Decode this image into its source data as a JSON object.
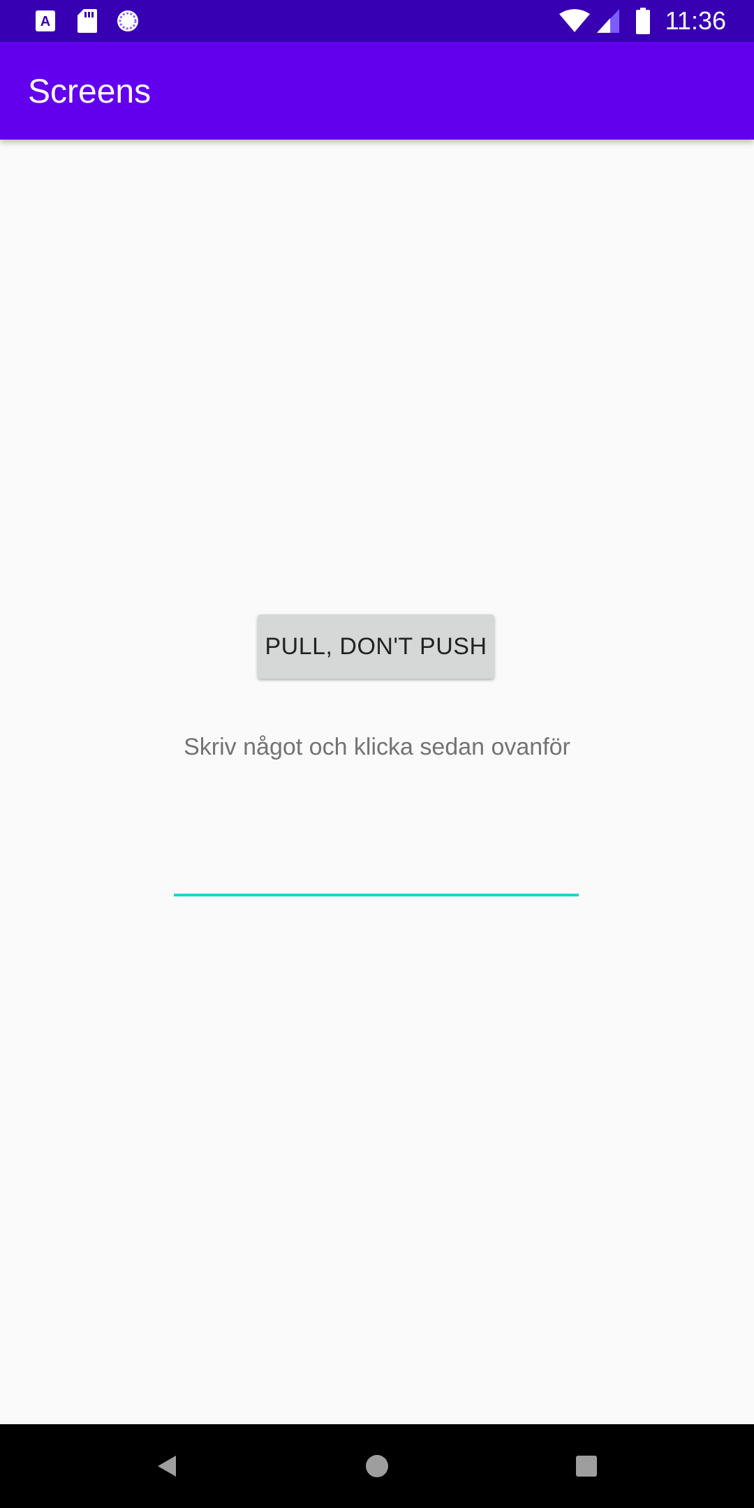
{
  "status_bar": {
    "time": "11:36",
    "notification_icons": [
      "font-icon",
      "sd-card-icon",
      "sync-icon"
    ],
    "system_icons": [
      "wifi-icon",
      "cellular-signal-icon",
      "battery-icon"
    ]
  },
  "app_bar": {
    "title": "Screens"
  },
  "main": {
    "button_label": "PULL, DON'T PUSH",
    "hint": "Skriv något och klicka sedan ovanför",
    "input_value": ""
  },
  "nav_bar": {
    "buttons": [
      "back-icon",
      "home-icon",
      "recents-icon"
    ]
  },
  "colors": {
    "status_bar": "#3700b3",
    "app_bar": "#6200ee",
    "background": "#fafafa",
    "button": "#d6d7d7",
    "input_underline": "#22d3cd",
    "hint_text": "#737373",
    "nav_bar": "#000000"
  }
}
